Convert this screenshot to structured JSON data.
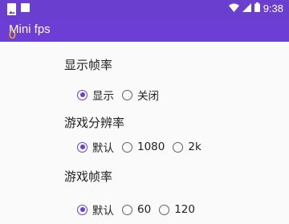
{
  "status_bar": {
    "time": "9:38"
  },
  "app": {
    "title": "Mini fps",
    "fps_overlay": "0"
  },
  "sections": [
    {
      "title": "显示帧率",
      "options": [
        "显示",
        "关闭"
      ],
      "selected": 0
    },
    {
      "title": "游戏分辨率",
      "options": [
        "默认",
        "1080",
        "2k"
      ],
      "selected": 0
    },
    {
      "title": "游戏帧率",
      "options": [
        "默认",
        "60",
        "120"
      ],
      "selected": 0
    }
  ],
  "colors": {
    "primary": "#6a3fd0",
    "fps_overlay": "#f5c400"
  },
  "icons": [
    "image-icon",
    "notification-icon",
    "wifi-icon",
    "signal-icon",
    "battery-icon"
  ]
}
